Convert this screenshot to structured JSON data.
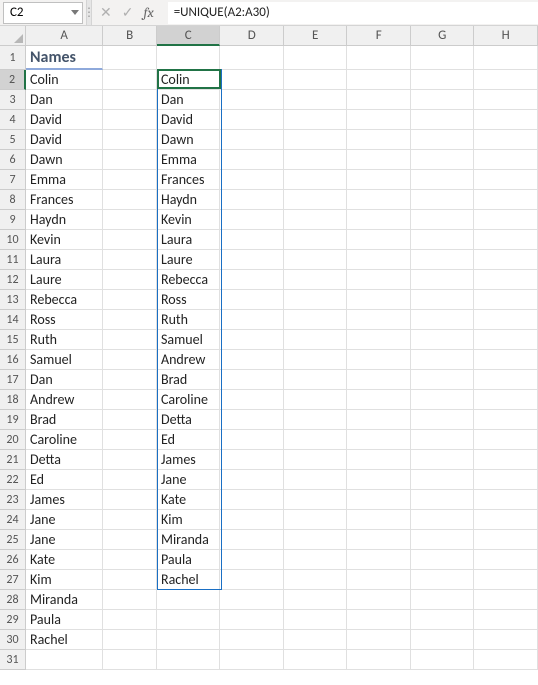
{
  "nameBox": "C2",
  "formula": "=UNIQUE(A2:A30)",
  "fxLabel": "fx",
  "columns": [
    "A",
    "B",
    "C",
    "D",
    "E",
    "F",
    "G",
    "H"
  ],
  "colWidths": {
    "A": 78,
    "B": 54,
    "C": 64,
    "D": 64,
    "E": 64,
    "F": 64,
    "G": 64,
    "H": 64
  },
  "rowCount": 31,
  "activeCell": {
    "col": "C",
    "row": 2
  },
  "spillRange": {
    "col": "C",
    "rowStart": 2,
    "rowEnd": 27
  },
  "header": {
    "A1": "Names"
  },
  "colA": [
    "Colin",
    "Dan",
    "David",
    "David",
    "Dawn",
    "Emma",
    "Frances",
    "Haydn",
    "Kevin",
    "Laura",
    "Laure",
    "Rebecca",
    "Ross",
    "Ruth",
    "Samuel",
    "Dan",
    "Andrew",
    "Brad",
    "Caroline",
    "Detta",
    "Ed",
    "James",
    "Jane",
    "Jane",
    "Kate",
    "Kim",
    "Miranda",
    "Paula",
    "Rachel"
  ],
  "colC": [
    "Colin",
    "Dan",
    "David",
    "Dawn",
    "Emma",
    "Frances",
    "Haydn",
    "Kevin",
    "Laura",
    "Laure",
    "Rebecca",
    "Ross",
    "Ruth",
    "Samuel",
    "Andrew",
    "Brad",
    "Caroline",
    "Detta",
    "Ed",
    "James",
    "Jane",
    "Kate",
    "Kim",
    "Miranda",
    "Paula",
    "Rachel"
  ],
  "chart_data": null
}
